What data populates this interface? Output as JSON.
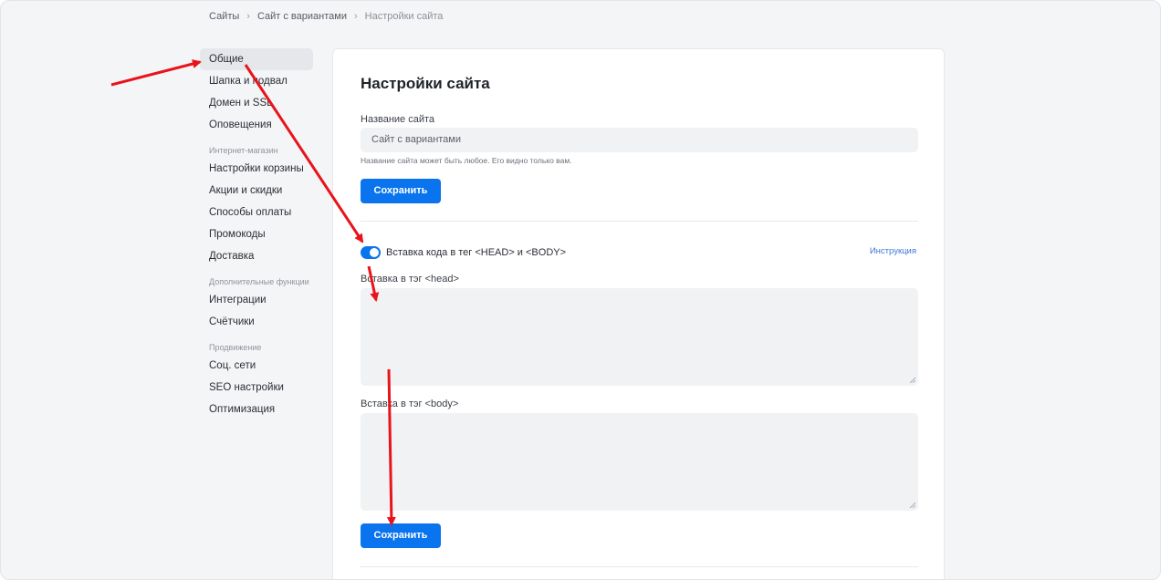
{
  "breadcrumb": {
    "items": [
      "Сайты",
      "Сайт с вариантами",
      "Настройки сайта"
    ]
  },
  "sidebar": {
    "items": [
      {
        "label": "Общие",
        "active": true
      },
      {
        "label": "Шапка и подвал"
      },
      {
        "label": "Домен и SSL"
      },
      {
        "label": "Оповещения"
      }
    ],
    "groups": [
      {
        "title": "Интернет-магазин",
        "items": [
          "Настройки корзины",
          "Акции и скидки",
          "Способы оплаты",
          "Промокоды",
          "Доставка"
        ]
      },
      {
        "title": "Дополнительные функции",
        "items": [
          "Интеграции",
          "Счётчики"
        ]
      },
      {
        "title": "Продвижение",
        "items": [
          "Соц. сети",
          "SEO настройки",
          "Оптимизация"
        ]
      }
    ]
  },
  "main": {
    "title": "Настройки сайта",
    "site_name": {
      "label": "Название сайта",
      "value": "Сайт с вариантами",
      "hint": "Название сайта может быть любое. Его видно только вам.",
      "save_label": "Сохранить"
    },
    "code": {
      "toggle_label": "Вставка кода в тег <HEAD> и <BODY>",
      "toggle_on": true,
      "instruction_link": "Инструкция",
      "head_label": "Вставка в тэг <head>",
      "head_value": "",
      "body_label": "Вставка в тэг <body>",
      "body_value": "",
      "save_label": "Сохранить"
    }
  },
  "colors": {
    "accent": "#0a74ee",
    "annotation_arrow": "#e8141b",
    "link": "#3c78d8"
  }
}
